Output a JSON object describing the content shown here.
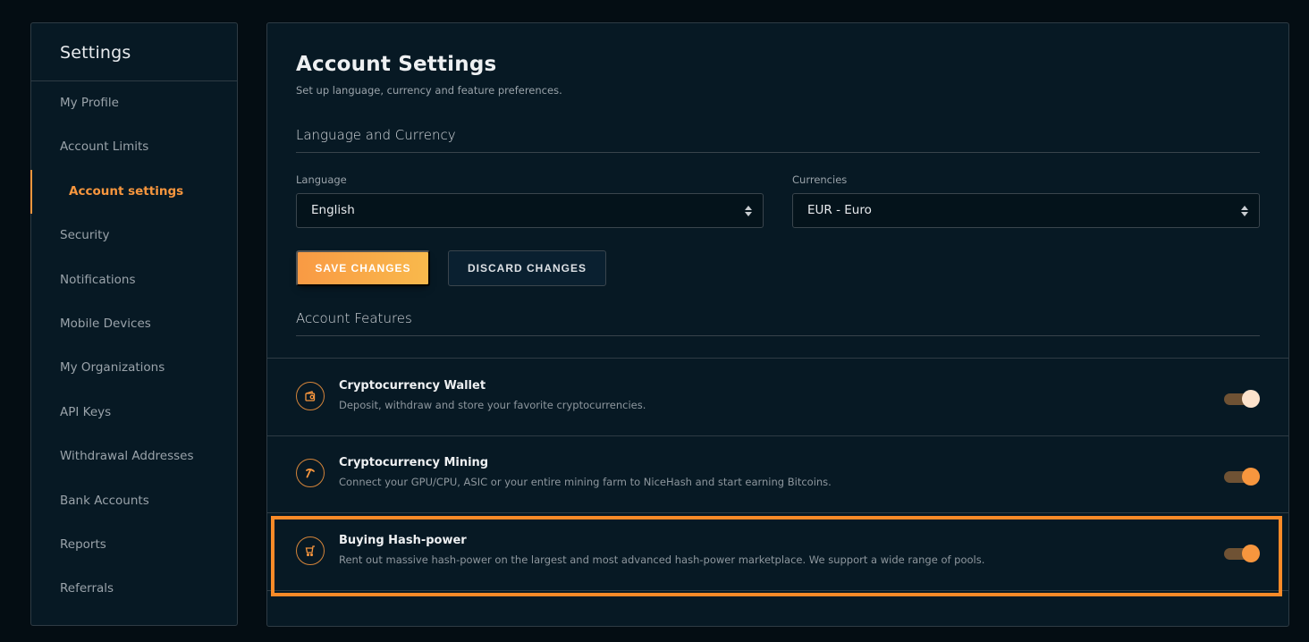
{
  "sidebar": {
    "title": "Settings",
    "items": [
      {
        "label": "My Profile",
        "active": false
      },
      {
        "label": "Account Limits",
        "active": false
      },
      {
        "label": "Account settings",
        "active": true
      },
      {
        "label": "Security",
        "active": false
      },
      {
        "label": "Notifications",
        "active": false
      },
      {
        "label": "Mobile Devices",
        "active": false
      },
      {
        "label": "My Organizations",
        "active": false
      },
      {
        "label": "API Keys",
        "active": false
      },
      {
        "label": "Withdrawal Addresses",
        "active": false
      },
      {
        "label": "Bank Accounts",
        "active": false
      },
      {
        "label": "Reports",
        "active": false
      },
      {
        "label": "Referrals",
        "active": false
      }
    ]
  },
  "main": {
    "title": "Account Settings",
    "subtitle": "Set up language, currency and feature preferences.",
    "language_section": {
      "title": "Language and Currency",
      "language": {
        "label": "Language",
        "value": "English"
      },
      "currency": {
        "label": "Currencies",
        "value": "EUR - Euro"
      }
    },
    "buttons": {
      "save_label": "SAVE CHANGES",
      "discard_label": "DISCARD CHANGES"
    },
    "features_section": {
      "title": "Account Features",
      "items": [
        {
          "icon": "wallet-icon",
          "title": "Cryptocurrency Wallet",
          "description": "Deposit, withdraw and store your favorite cryptocurrencies.",
          "enabled": true
        },
        {
          "icon": "pickaxe-icon",
          "title": "Cryptocurrency Mining",
          "description": "Connect your GPU/CPU, ASIC or your entire mining farm to NiceHash and start earning Bitcoins.",
          "enabled": true
        },
        {
          "icon": "cart-icon",
          "title": "Buying Hash-power",
          "description": "Rent out massive hash-power on the largest and most advanced hash-power marketplace. We support a wide range of pools.",
          "enabled": true,
          "highlighted": true
        }
      ]
    }
  },
  "colors": {
    "accent": "#f7963e",
    "highlight_border": "#f98a28",
    "panel_bg": "#071924",
    "page_bg": "#040d13"
  }
}
